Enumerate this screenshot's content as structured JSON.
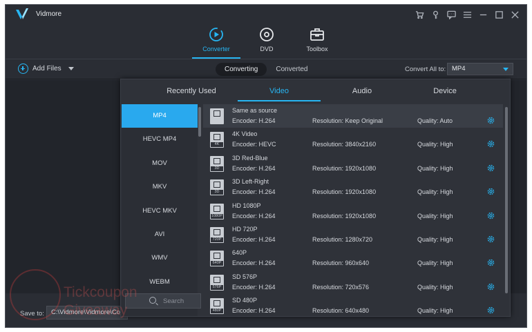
{
  "app": {
    "title": "Vidmore"
  },
  "title_icons": [
    "cart-icon",
    "key-icon",
    "chat-icon",
    "menu-icon",
    "minimize-icon",
    "maximize-icon",
    "close-icon"
  ],
  "nav": {
    "tabs": [
      {
        "label": "Converter",
        "icon": "converter-icon",
        "active": true
      },
      {
        "label": "DVD",
        "icon": "dvd-icon",
        "active": false
      },
      {
        "label": "Toolbox",
        "icon": "toolbox-icon",
        "active": false
      }
    ]
  },
  "toolbar": {
    "add_files": "Add Files",
    "converting": "Converting",
    "converted": "Converted",
    "convert_all_label": "Convert All to:",
    "convert_all_value": "MP4"
  },
  "bottom": {
    "save_to": "Save to:",
    "path": "C:\\Vidmore\\Vidmore\\Conve"
  },
  "panel": {
    "tabs": [
      "Recently Used",
      "Video",
      "Audio",
      "Device"
    ],
    "active_tab": "Video",
    "formats": [
      "MP4",
      "HEVC MP4",
      "MOV",
      "MKV",
      "HEVC MKV",
      "AVI",
      "WMV",
      "WEBM"
    ],
    "active_format": "MP4",
    "search_placeholder": "Search",
    "presets": [
      {
        "name": "Same as source",
        "encoder": "Encoder: H.264",
        "resolution": "Resolution: Keep Original",
        "quality": "Quality: Auto",
        "tag": ""
      },
      {
        "name": "4K Video",
        "encoder": "Encoder: HEVC",
        "resolution": "Resolution: 3840x2160",
        "quality": "Quality: High",
        "tag": "4K"
      },
      {
        "name": "3D Red-Blue",
        "encoder": "Encoder: H.264",
        "resolution": "Resolution: 1920x1080",
        "quality": "Quality: High",
        "tag": "3D"
      },
      {
        "name": "3D Left-Right",
        "encoder": "Encoder: H.264",
        "resolution": "Resolution: 1920x1080",
        "quality": "Quality: High",
        "tag": "3D"
      },
      {
        "name": "HD 1080P",
        "encoder": "Encoder: H.264",
        "resolution": "Resolution: 1920x1080",
        "quality": "Quality: High",
        "tag": "1080P"
      },
      {
        "name": "HD 720P",
        "encoder": "Encoder: H.264",
        "resolution": "Resolution: 1280x720",
        "quality": "Quality: High",
        "tag": "720P"
      },
      {
        "name": "640P",
        "encoder": "Encoder: H.264",
        "resolution": "Resolution: 960x640",
        "quality": "Quality: High",
        "tag": "640P"
      },
      {
        "name": "SD 576P",
        "encoder": "Encoder: H.264",
        "resolution": "Resolution: 720x576",
        "quality": "Quality: High",
        "tag": "576P"
      },
      {
        "name": "SD 480P",
        "encoder": "Encoder: H.264",
        "resolution": "Resolution: 640x480",
        "quality": "Quality: High",
        "tag": "480P"
      }
    ]
  },
  "watermark": {
    "line1": "Tickcoupon",
    "line2": "Giveaway"
  },
  "colors": {
    "accent": "#27b6f3",
    "selected_format": "#29a9ee",
    "window_bg": "#2a2d34",
    "panel_bg": "#2f3239"
  }
}
